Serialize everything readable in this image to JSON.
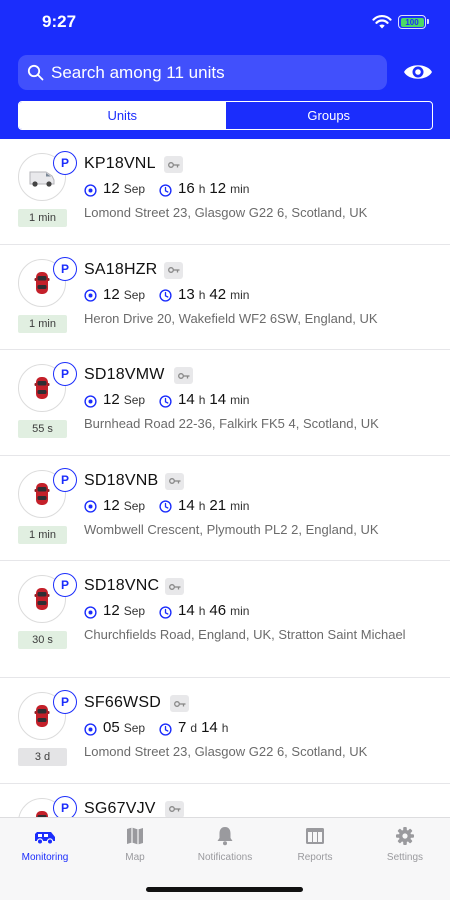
{
  "status_bar": {
    "time": "9:27",
    "battery": "100"
  },
  "search": {
    "placeholder": "Search among 11 units"
  },
  "segments": {
    "units": "Units",
    "groups": "Groups"
  },
  "units": [
    {
      "name": "KP18VNL",
      "icon": "van-icon",
      "badge": "P",
      "age": "1 min",
      "age_color": "green",
      "date_num": "12",
      "date_mon": "Sep",
      "dur_a": "16",
      "unit_a": "h",
      "dur_b": "12",
      "unit_b": "min",
      "address": "Lomond Street 23, Glasgow G22 6, Scotland, UK"
    },
    {
      "name": "SA18HZR",
      "icon": "car-icon",
      "badge": "P",
      "age": "1 min",
      "age_color": "green",
      "date_num": "12",
      "date_mon": "Sep",
      "dur_a": "13",
      "unit_a": "h",
      "dur_b": "42",
      "unit_b": "min",
      "address": "Heron Drive 20, Wakefield WF2 6SW, England, UK"
    },
    {
      "name": "SD18VMW",
      "icon": "car-icon",
      "badge": "P",
      "age": "55 s",
      "age_color": "green",
      "date_num": "12",
      "date_mon": "Sep",
      "dur_a": "14",
      "unit_a": "h",
      "dur_b": "14",
      "unit_b": "min",
      "address": "Burnhead Road 22-36, Falkirk FK5 4, Scotland, UK"
    },
    {
      "name": "SD18VNB",
      "icon": "car-icon",
      "badge": "P",
      "age": "1 min",
      "age_color": "green",
      "date_num": "12",
      "date_mon": "Sep",
      "dur_a": "14",
      "unit_a": "h",
      "dur_b": "21",
      "unit_b": "min",
      "address": "Wombwell Crescent, Plymouth PL2 2, England, UK"
    },
    {
      "name": "SD18VNC",
      "icon": "car-icon",
      "badge": "P",
      "age": "30 s",
      "age_color": "green",
      "date_num": "12",
      "date_mon": "Sep",
      "dur_a": "14",
      "unit_a": "h",
      "dur_b": "46",
      "unit_b": "min",
      "address": "Churchfields Road, England, UK, Stratton Saint Michael"
    },
    {
      "name": "SF66WSD",
      "icon": "car-icon",
      "badge": "P",
      "age": "3 d",
      "age_color": "gray",
      "date_num": "05",
      "date_mon": "Sep",
      "dur_a": "7",
      "unit_a": "d",
      "dur_b": "14",
      "unit_b": "h",
      "address": "Lomond Street 23, Glasgow G22 6, Scotland, UK"
    },
    {
      "name": "SG67VJV",
      "icon": "car-icon",
      "badge": "P",
      "age": "",
      "age_color": "gray",
      "date_num": "",
      "date_mon": "",
      "dur_a": "",
      "unit_a": "",
      "dur_b": "",
      "unit_b": "",
      "address": ""
    }
  ],
  "tabs": [
    {
      "label": "Monitoring",
      "icon": "monitoring-icon",
      "active": true
    },
    {
      "label": "Map",
      "icon": "map-icon",
      "active": false
    },
    {
      "label": "Notifications",
      "icon": "bell-icon",
      "active": false
    },
    {
      "label": "Reports",
      "icon": "reports-icon",
      "active": false
    },
    {
      "label": "Settings",
      "icon": "gear-icon",
      "active": false
    }
  ],
  "colors": {
    "brand": "#1b2dfc",
    "age_green": "#e1efe1",
    "age_gray": "#e4e4e6"
  }
}
